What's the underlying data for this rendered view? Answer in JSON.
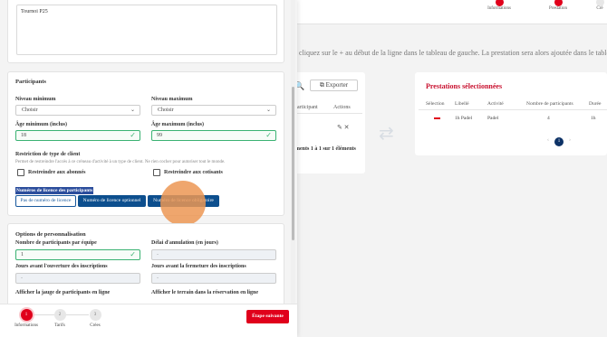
{
  "background": {
    "steps": [
      {
        "label": "Informations"
      },
      {
        "label": "Prestation"
      },
      {
        "label": "Cré"
      }
    ],
    "instructions": "cliquez sur le + au début de la ligne dans le tableau de gauche. La prestation sera alors ajoutée dans le tableau de droite. Vo",
    "export_label": "Exporter",
    "left_table": {
      "headers": [
        "participant",
        "Actions"
      ],
      "pagination_text": "ments 1 à 1 sur 1 éléments"
    },
    "right_table": {
      "title": "Prestations sélectionnées",
      "headers": [
        "Sélection",
        "Libellé",
        "Activité",
        "Nombre de participants",
        "Durée"
      ],
      "row": {
        "libelle": "1h Padel",
        "activite": "Padel",
        "participants": "4",
        "duree": "1h"
      },
      "current_page": "1"
    }
  },
  "form": {
    "description_text": "Tournoi P25",
    "participants": {
      "title": "Participants",
      "niveau_min_label": "Niveau minimum",
      "niveau_min_value": "Choisir",
      "niveau_max_label": "Niveau maximum",
      "niveau_max_value": "Choisir",
      "age_min_label": "Âge minimum (inclus)",
      "age_min_value": "18",
      "age_max_label": "Âge maximum (inclus)",
      "age_max_value": "99",
      "restriction_label": "Restriction de type de client",
      "restriction_hint": "Permet de restreindre l'accès à ce créneau d'activité à un type de client. Ne rien cocher pour autoriser tout le monde.",
      "abonnes_label": "Restreindre aux abonnés",
      "cotisants_label": "Restreindre aux cotisants",
      "licence_label": "Numéros de licence des participants",
      "licence_options": [
        "Pas de numéro de licence",
        "Numéro de licence optionnel",
        "Numéro de licence obligatoire"
      ]
    },
    "personnalisation": {
      "title": "Options de personnalisation",
      "nb_participants_label": "Nombre de participants par équipe",
      "nb_participants_value": "1",
      "delai_annulation_label": "Délai d'annulation (en jours)",
      "delai_annulation_value": "-",
      "jours_ouverture_label": "Jours avant l'ouverture des inscriptions",
      "jours_ouverture_value": "-",
      "jours_fermeture_label": "Jours avant la fermeture des inscriptions",
      "jours_fermeture_value": "-",
      "jauge_label": "Afficher la jauge de participants en ligne",
      "terrain_label": "Afficher le terrain dans la réservation en ligne"
    }
  },
  "footer": {
    "steps": [
      {
        "number": "1",
        "label": "Informations"
      },
      {
        "number": "2",
        "label": "Tarifs"
      },
      {
        "number": "3",
        "label": "Crées"
      }
    ],
    "next_label": "Étape suivante"
  },
  "colors": {
    "accent_red": "#e0001b",
    "primary_blue": "#0d4f8e",
    "valid_green": "#3bb273"
  }
}
